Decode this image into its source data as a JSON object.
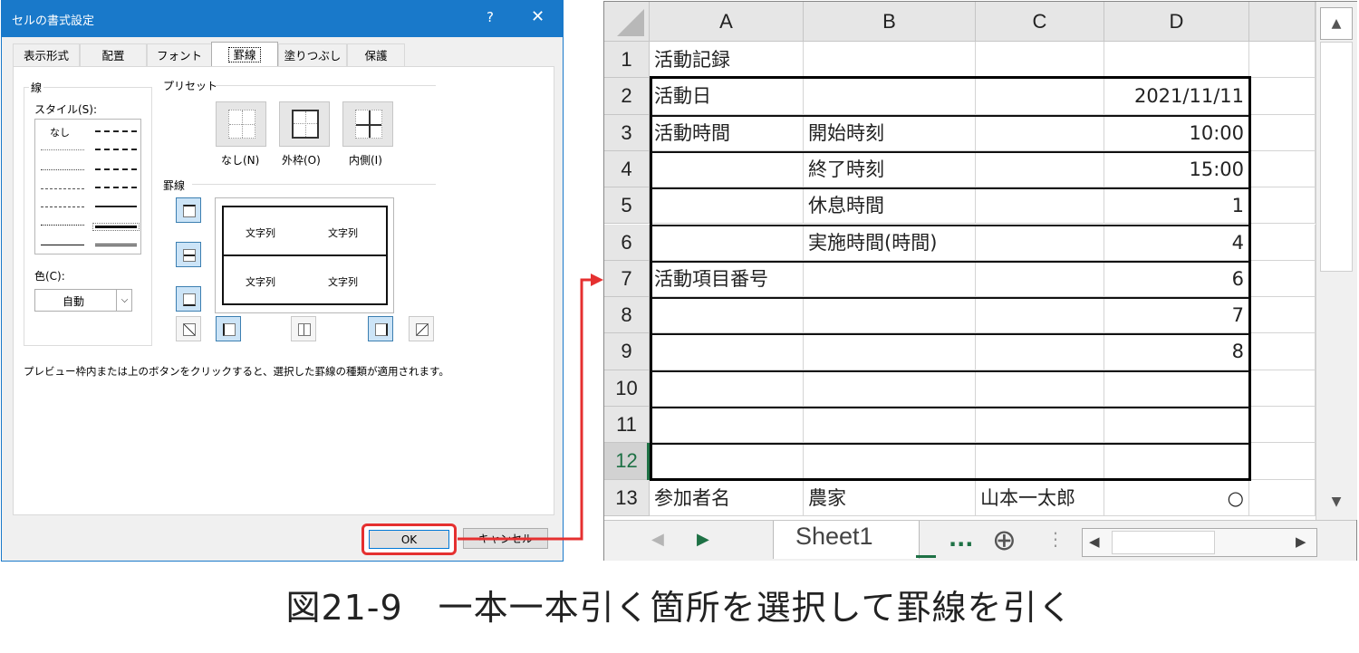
{
  "dialog": {
    "title": "セルの書式設定",
    "help_glyph": "?",
    "close_glyph": "✕",
    "tabs": [
      {
        "label": "表示形式"
      },
      {
        "label": "配置"
      },
      {
        "label": "フォント"
      },
      {
        "label": "罫線"
      },
      {
        "label": "塗りつぶし"
      },
      {
        "label": "保護"
      }
    ],
    "line_group_label": "線",
    "style_label": "スタイル(S):",
    "style_none": "なし",
    "color_label": "色(C):",
    "color_value": "自動",
    "preset_label": "プリセット",
    "presets": [
      {
        "label": "なし(N)"
      },
      {
        "label": "外枠(O)"
      },
      {
        "label": "内側(I)"
      }
    ],
    "border_label": "罫線",
    "preview_text": [
      "文字列",
      "文字列",
      "文字列",
      "文字列"
    ],
    "hint": "プレビュー枠内または上のボタンをクリックすると、選択した罫線の種類が適用されます。",
    "ok_label": "OK",
    "cancel_label": "キャンセル"
  },
  "sheet": {
    "columns": [
      "A",
      "B",
      "C",
      "D"
    ],
    "rows": [
      {
        "num": "1",
        "a": "活動記録",
        "b": "",
        "c": "",
        "d": ""
      },
      {
        "num": "2",
        "a": "活動日",
        "b": "",
        "c": "",
        "d": "2021/11/11"
      },
      {
        "num": "3",
        "a": "活動時間",
        "b": "開始時刻",
        "c": "",
        "d": "10:00"
      },
      {
        "num": "4",
        "a": "",
        "b": "終了時刻",
        "c": "",
        "d": "15:00"
      },
      {
        "num": "5",
        "a": "",
        "b": "休息時間",
        "c": "",
        "d": "1"
      },
      {
        "num": "6",
        "a": "",
        "b": "実施時間(時間)",
        "c": "",
        "d": "4"
      },
      {
        "num": "7",
        "a": "活動項目番号",
        "b": "",
        "c": "",
        "d": "6"
      },
      {
        "num": "8",
        "a": "",
        "b": "",
        "c": "",
        "d": "7"
      },
      {
        "num": "9",
        "a": "",
        "b": "",
        "c": "",
        "d": "8"
      },
      {
        "num": "10",
        "a": "",
        "b": "",
        "c": "",
        "d": ""
      },
      {
        "num": "11",
        "a": "",
        "b": "",
        "c": "",
        "d": ""
      },
      {
        "num": "12",
        "a": "",
        "b": "",
        "c": "",
        "d": ""
      },
      {
        "num": "13",
        "a": "参加者名",
        "b": "農家",
        "c": "山本一太郎",
        "d": "○"
      }
    ],
    "sheet_tab": "Sheet1",
    "more_tabs": "...",
    "add_sheet_glyph": "⊕"
  },
  "caption": "図21-9　一本一本引く箇所を選択して罫線を引く",
  "colors": {
    "accent": "#1979ca",
    "highlight": "#e53030",
    "excel_green": "#1e7145"
  }
}
